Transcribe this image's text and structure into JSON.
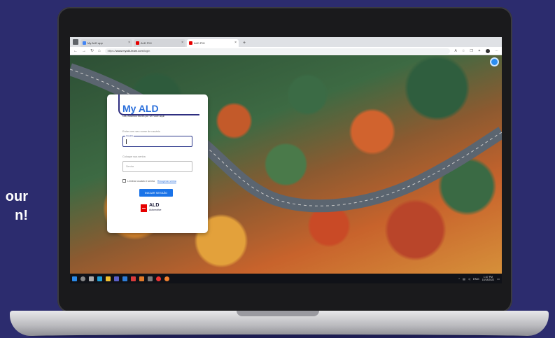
{
  "promo": {
    "line1": "our",
    "line2": "n!"
  },
  "browser": {
    "tabs": [
      {
        "label": "My ALD app",
        "active": false
      },
      {
        "label": "ALD PHI",
        "active": false
      },
      {
        "label": "ALD PHI",
        "active": true
      }
    ],
    "new_tab_glyph": "+",
    "url_prefix": "https://",
    "url_host": "www.myald-team.com",
    "url_path": "/login"
  },
  "login": {
    "title": "My ALD",
    "subtitle": "Olá, estamos felizes por ver você aqui!",
    "username_label": "Entre com seu nome de usuário",
    "username_float": "Usuário",
    "password_label": "Coloque sua senha",
    "password_placeholder": "Senha",
    "remember_label": "Lembrar usuário e senha",
    "recover_link": "Recuperar senha",
    "submit_label": "INICIAR SESSÃO"
  },
  "brand": {
    "name": "ALD",
    "subtitle": "Automotive",
    "accent_color": "#e60000",
    "primary_color": "#1a73e8"
  },
  "taskbar": {
    "clock_time": "1:47 PM",
    "clock_date": "10/18/2022",
    "language": "ENG"
  }
}
